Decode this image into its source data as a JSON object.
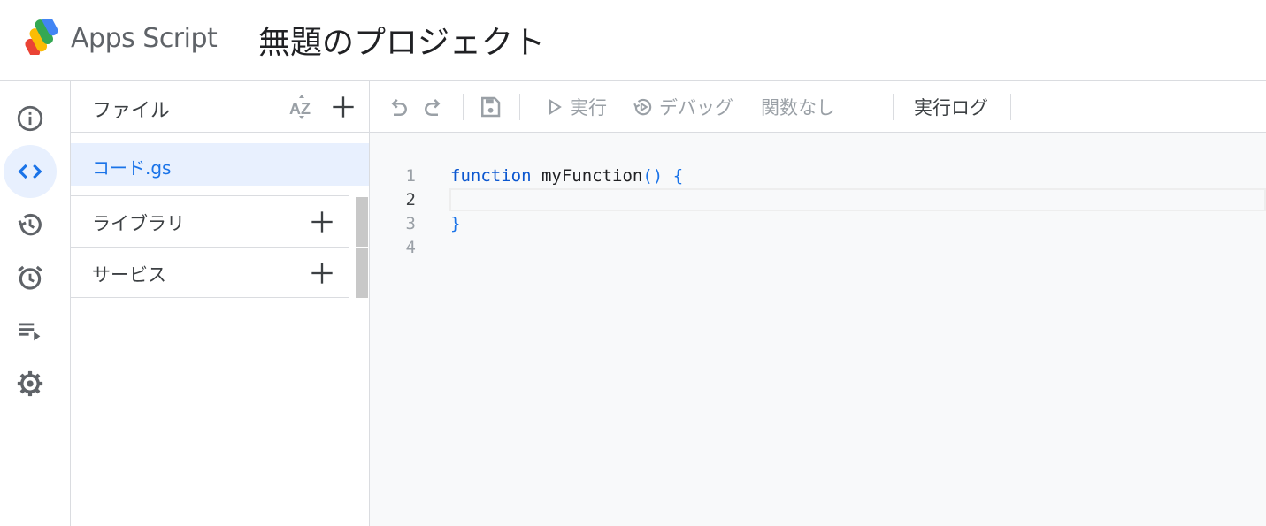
{
  "header": {
    "app_name": "Apps Script",
    "project_title": "無題のプロジェクト"
  },
  "rail": {
    "items": [
      {
        "icon": "info-icon",
        "active": false
      },
      {
        "icon": "code-icon",
        "active": true
      },
      {
        "icon": "history-icon",
        "active": false
      },
      {
        "icon": "alarm-clock-icon",
        "active": false
      },
      {
        "icon": "executions-icon",
        "active": false
      },
      {
        "icon": "gear-icon",
        "active": false
      }
    ]
  },
  "files": {
    "title": "ファイル",
    "items": [
      {
        "name": "コード.gs",
        "selected": true
      }
    ],
    "libraries_label": "ライブラリ",
    "services_label": "サービス"
  },
  "toolbar": {
    "run_label": "実行",
    "debug_label": "デバッグ",
    "function_select": "関数なし",
    "execution_log_label": "実行ログ"
  },
  "editor": {
    "line_numbers": [
      "1",
      "2",
      "3",
      "4"
    ],
    "current_line": 2,
    "lines": {
      "l1_keyword": "function",
      "l1_name": "myFunction",
      "l1_parens": "()",
      "l1_brace": "{",
      "l3_brace": "}"
    }
  },
  "colors": {
    "accent": "#1a73e8",
    "selected_bg": "#e8f0fe",
    "border": "#dadce0",
    "editor_bg": "#f8f9fa",
    "icon_gray": "#5f6368"
  }
}
